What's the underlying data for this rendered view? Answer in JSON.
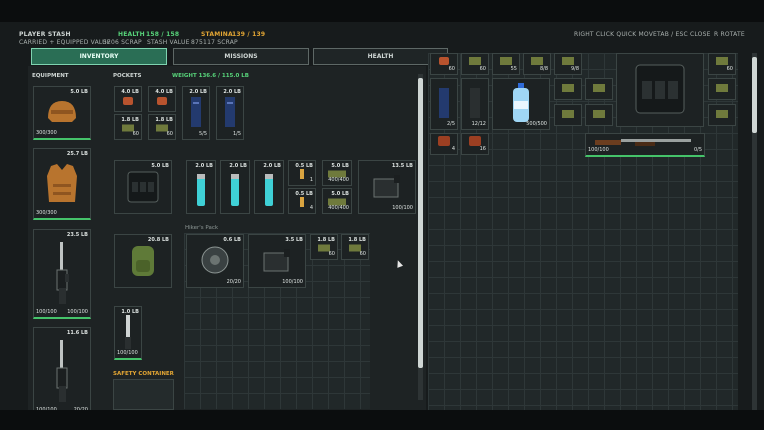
{
  "header": {
    "title": "PLAYER STASH",
    "health_label": "HEALTH",
    "health_value": "158 / 158",
    "stamina_label": "STAMINA",
    "stamina_value": "139 / 139",
    "carried_label": "CARRIED + EQUIPPED VALUE",
    "carried_value": "5206 SCRAP",
    "stash_label": "STASH VALUE",
    "stash_value": "875117 SCRAP",
    "hints": [
      "RIGHT CLICK QUICK MOVE",
      "TAB / ESC CLOSE",
      "R ROTATE"
    ]
  },
  "tabs": [
    {
      "label": "INVENTORY",
      "active": true
    },
    {
      "label": "MISSIONS",
      "active": false
    },
    {
      "label": "HEALTH",
      "active": false
    }
  ],
  "sections": {
    "equipment": "EQUIPMENT",
    "pockets": "POCKETS",
    "weight": "WEIGHT 136.6 / 115.0 LB",
    "backpack_name": "Hiker's Pack",
    "safety": "SAFETY CONTAINER"
  },
  "equipment": [
    {
      "name": "helmet",
      "icon": "helmet-icon",
      "weight": "5.0 LB",
      "durability": "300/300"
    },
    {
      "name": "body-armor",
      "icon": "vest-icon",
      "weight": "25.7 LB",
      "durability": "300/300"
    },
    {
      "name": "primary-weapon",
      "icon": "rifle-icon",
      "weight": "23.5 LB",
      "durability": "100/100",
      "ammo": "100/100"
    },
    {
      "name": "secondary-weapon",
      "icon": "rifle-icon",
      "weight": "11.6 LB",
      "durability": "100/100",
      "ammo": "20/20"
    }
  ],
  "pockets": [
    {
      "weight": "4.0 LB",
      "icon": "meat-icon",
      "qty": ""
    },
    {
      "weight": "4.0 LB",
      "icon": "meat-icon",
      "qty": ""
    },
    {
      "weight": "2.0 LB",
      "icon": "magazine-icon",
      "qty": "5/5"
    },
    {
      "weight": "2.0 LB",
      "icon": "magazine-icon",
      "qty": "1/5"
    },
    {
      "weight": "1.8 LB",
      "icon": "ammo-box-icon",
      "qty": "60"
    },
    {
      "weight": "1.8 LB",
      "icon": "ammo-box-icon",
      "qty": "60"
    }
  ],
  "rig": {
    "vest": {
      "weight": "5.0 LB",
      "icon": "rig-icon"
    },
    "items": [
      {
        "weight": "2.0 LB",
        "icon": "battery-icon",
        "qty": ""
      },
      {
        "weight": "2.0 LB",
        "icon": "battery-icon",
        "qty": ""
      },
      {
        "weight": "2.0 LB",
        "icon": "battery-icon",
        "qty": ""
      },
      {
        "weight": "0.5 LB",
        "icon": "round-icon",
        "qty": "1"
      },
      {
        "weight": "0.5 LB",
        "icon": "round-icon",
        "qty": "4"
      },
      {
        "weight": "5.0 LB",
        "icon": "ammo-pile-icon",
        "qty": "400/400"
      },
      {
        "weight": "5.0 LB",
        "icon": "ammo-pile-icon",
        "qty": "400/400"
      },
      {
        "weight": "13.5 LB",
        "icon": "drum-mag-icon",
        "qty": "100/100"
      }
    ]
  },
  "backpack": {
    "bag": {
      "weight": "20.8 LB",
      "icon": "backpack-icon"
    },
    "items": [
      {
        "weight": "0.6 LB",
        "icon": "drum-icon",
        "qty": "20/20"
      },
      {
        "weight": "3.5 LB",
        "icon": "drum-mag-icon",
        "qty": "100/100"
      },
      {
        "weight": "1.8 LB",
        "icon": "ammo-box-icon",
        "qty": "60"
      },
      {
        "weight": "1.8 LB",
        "icon": "ammo-box-icon",
        "qty": "60"
      }
    ]
  },
  "knife": {
    "weight": "1.0 LB",
    "icon": "knife-icon",
    "durability": "100/100"
  },
  "stash": {
    "items": [
      {
        "icon": "meat-icon",
        "qty": "60"
      },
      {
        "icon": "ammo-box-icon",
        "qty": "60"
      },
      {
        "icon": "ammo-box-icon",
        "qty": "55"
      },
      {
        "icon": "ammo-box-icon",
        "qty": "8/8"
      },
      {
        "icon": "ammo-box-icon",
        "qty": "9/8"
      },
      {
        "icon": "ammo-box-icon",
        "qty": "60"
      },
      {
        "icon": "magazine-icon",
        "qty": "2/5"
      },
      {
        "icon": "magazine-icon",
        "qty": "12/12"
      },
      {
        "icon": "water-bottle-icon",
        "qty": "500/500"
      },
      {
        "icon": "meat-icon",
        "qty": "4"
      },
      {
        "icon": "meat-icon",
        "qty": "16"
      },
      {
        "icon": "shotgun-icon",
        "qty": "0/5",
        "dur": "100/100"
      }
    ]
  }
}
